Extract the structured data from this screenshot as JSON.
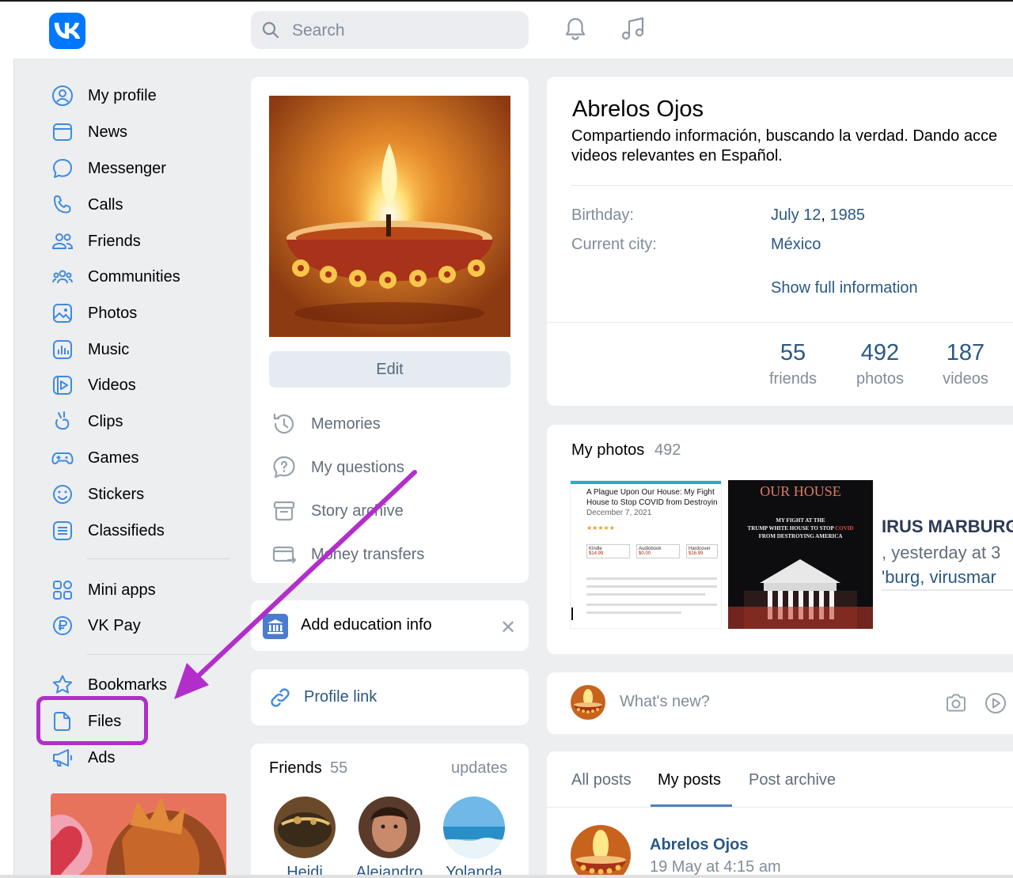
{
  "header": {
    "search_placeholder": "Search"
  },
  "colors": {
    "brand": "#0077ff",
    "link": "#2a5885",
    "muted": "#818c99",
    "annotation": "#b22ecb"
  },
  "sidebar": {
    "items": [
      {
        "label": "My profile",
        "icon": "user-circle-icon"
      },
      {
        "label": "News",
        "icon": "news-icon"
      },
      {
        "label": "Messenger",
        "icon": "chat-bubble-icon"
      },
      {
        "label": "Calls",
        "icon": "phone-icon"
      },
      {
        "label": "Friends",
        "icon": "friends-icon"
      },
      {
        "label": "Communities",
        "icon": "communities-icon"
      },
      {
        "label": "Photos",
        "icon": "photo-icon"
      },
      {
        "label": "Music",
        "icon": "music-icon"
      },
      {
        "label": "Videos",
        "icon": "video-icon"
      },
      {
        "label": "Clips",
        "icon": "clips-icon"
      },
      {
        "label": "Games",
        "icon": "gamepad-icon"
      },
      {
        "label": "Stickers",
        "icon": "smile-icon"
      },
      {
        "label": "Classifieds",
        "icon": "classifieds-icon"
      }
    ],
    "items2": [
      {
        "label": "Mini apps",
        "icon": "apps-grid-icon"
      },
      {
        "label": "VK Pay",
        "icon": "ruble-coin-icon"
      }
    ],
    "items3": [
      {
        "label": "Bookmarks",
        "icon": "star-icon"
      },
      {
        "label": "Files",
        "icon": "file-icon"
      },
      {
        "label": "Ads",
        "icon": "megaphone-icon"
      }
    ]
  },
  "profile_card": {
    "edit_label": "Edit",
    "menu": [
      {
        "label": "Memories",
        "icon": "memories-clock-icon"
      },
      {
        "label": "My questions",
        "icon": "question-bubble-icon"
      },
      {
        "label": "Story archive",
        "icon": "archive-box-icon"
      },
      {
        "label": "Money transfers",
        "icon": "money-transfer-icon"
      }
    ]
  },
  "education": {
    "label": "Add education info",
    "close": "✕"
  },
  "profile_link": {
    "label": "Profile link"
  },
  "friends_block": {
    "title": "Friends",
    "count": "55",
    "updates": "updates",
    "people": [
      "Heidi",
      "Alejandro",
      "Yolanda"
    ]
  },
  "profile": {
    "name": "Abrelos Ojos",
    "status": "Compartiendo información, buscando la verdad. Dando acceso a videos relevantes en Español.",
    "status_line1": "Compartiendo información, buscando la verdad. Dando acce",
    "status_line2": "videos relevantes en Español.",
    "birthday_label": "Birthday:",
    "birthday_date": "July 12",
    "birthday_year": "1985",
    "city_label": "Current city:",
    "city": "México",
    "show_full": "Show full information",
    "stats": [
      {
        "value": "55",
        "label": "friends"
      },
      {
        "value": "492",
        "label": "photos"
      },
      {
        "value": "187",
        "label": "videos"
      }
    ]
  },
  "photos": {
    "title": "My photos",
    "count": "492",
    "photo1": {
      "lines": [
        "A Plague Upon Our House: My Fight",
        "House to Stop COVID from Destroyin",
        "December 7, 2021"
      ],
      "formats": [
        "Kindle",
        "Audiobook",
        "Hardcover"
      ],
      "prices": [
        "$14.99",
        "$0.00",
        "$16.99"
      ]
    },
    "photo2": {
      "title": "OUR HOUSE",
      "subtitle1": "MY FIGHT AT THE",
      "subtitle2a": "TRUMP WHITE HOUSE TO STOP ",
      "subtitle2b": "COVID",
      "subtitle3": "FROM DESTROYING AMERICA"
    },
    "photo3": {
      "line1": "IRUS MARBURG",
      "line2": ", yesterday at 3",
      "line3": "'burg, virusmar"
    }
  },
  "composer": {
    "placeholder": "What's new?"
  },
  "posts": {
    "tabs": [
      "All posts",
      "My posts",
      "Post archive"
    ],
    "active_tab": "My posts",
    "author": "Abrelos Ojos",
    "date": "19 May at 4:15 am"
  }
}
